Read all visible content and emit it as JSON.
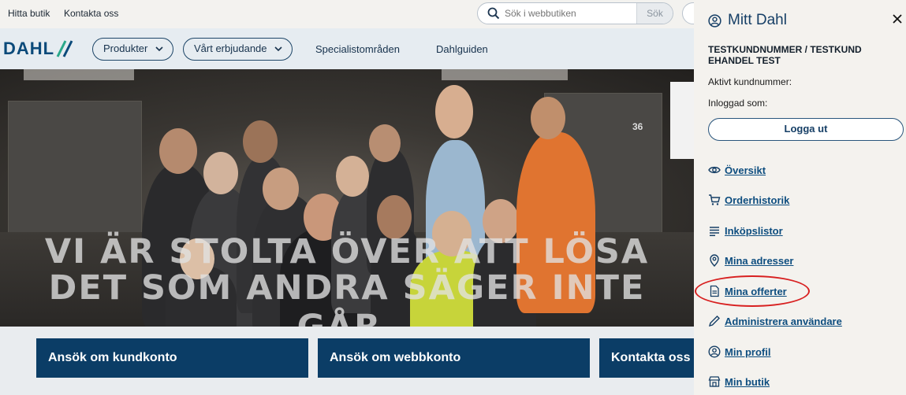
{
  "topbar": {
    "find_store": "Hitta butik",
    "contact": "Kontakta oss",
    "search_placeholder": "Sök i webbutiken",
    "search_button": "Sök"
  },
  "nav": {
    "logo_text": "DAHL",
    "products": "Produkter",
    "offer": "Vårt erbjudande",
    "specialist": "Specialistområden",
    "guide": "Dahlguiden"
  },
  "hero": {
    "line1": "VI ÄR STOLTA ÖVER ATT LÖSA",
    "line2": "DET SOM ANDRA SÄGER INTE GÅR.",
    "shelf_number": "36"
  },
  "cta": {
    "apply_customer": "Ansök om kundkonto",
    "apply_web": "Ansök om webbkonto",
    "contact": "Kontakta oss"
  },
  "panel": {
    "title": "Mitt Dahl",
    "customer": "TESTKUNDNUMMER / TESTKUND EHANDEL TEST",
    "active_label": "Aktivt kundnummer:",
    "logged_in_label": "Inloggad som:",
    "logout": "Logga ut",
    "menu": [
      {
        "label": "Översikt",
        "icon": "eye-icon"
      },
      {
        "label": "Orderhistorik",
        "icon": "cart-icon"
      },
      {
        "label": "Inköpslistor",
        "icon": "list-icon"
      },
      {
        "label": "Mina adresser",
        "icon": "location-pin-icon"
      },
      {
        "label": "Mina offerter",
        "icon": "document-icon"
      },
      {
        "label": "Administrera användare",
        "icon": "pencil-icon"
      },
      {
        "label": "Min profil",
        "icon": "user-circle-icon"
      },
      {
        "label": "Min butik",
        "icon": "store-icon"
      }
    ]
  },
  "colors": {
    "brand_navy": "#0b3d66",
    "link_blue": "#0d4d7f",
    "highlight_red": "#d82020"
  }
}
